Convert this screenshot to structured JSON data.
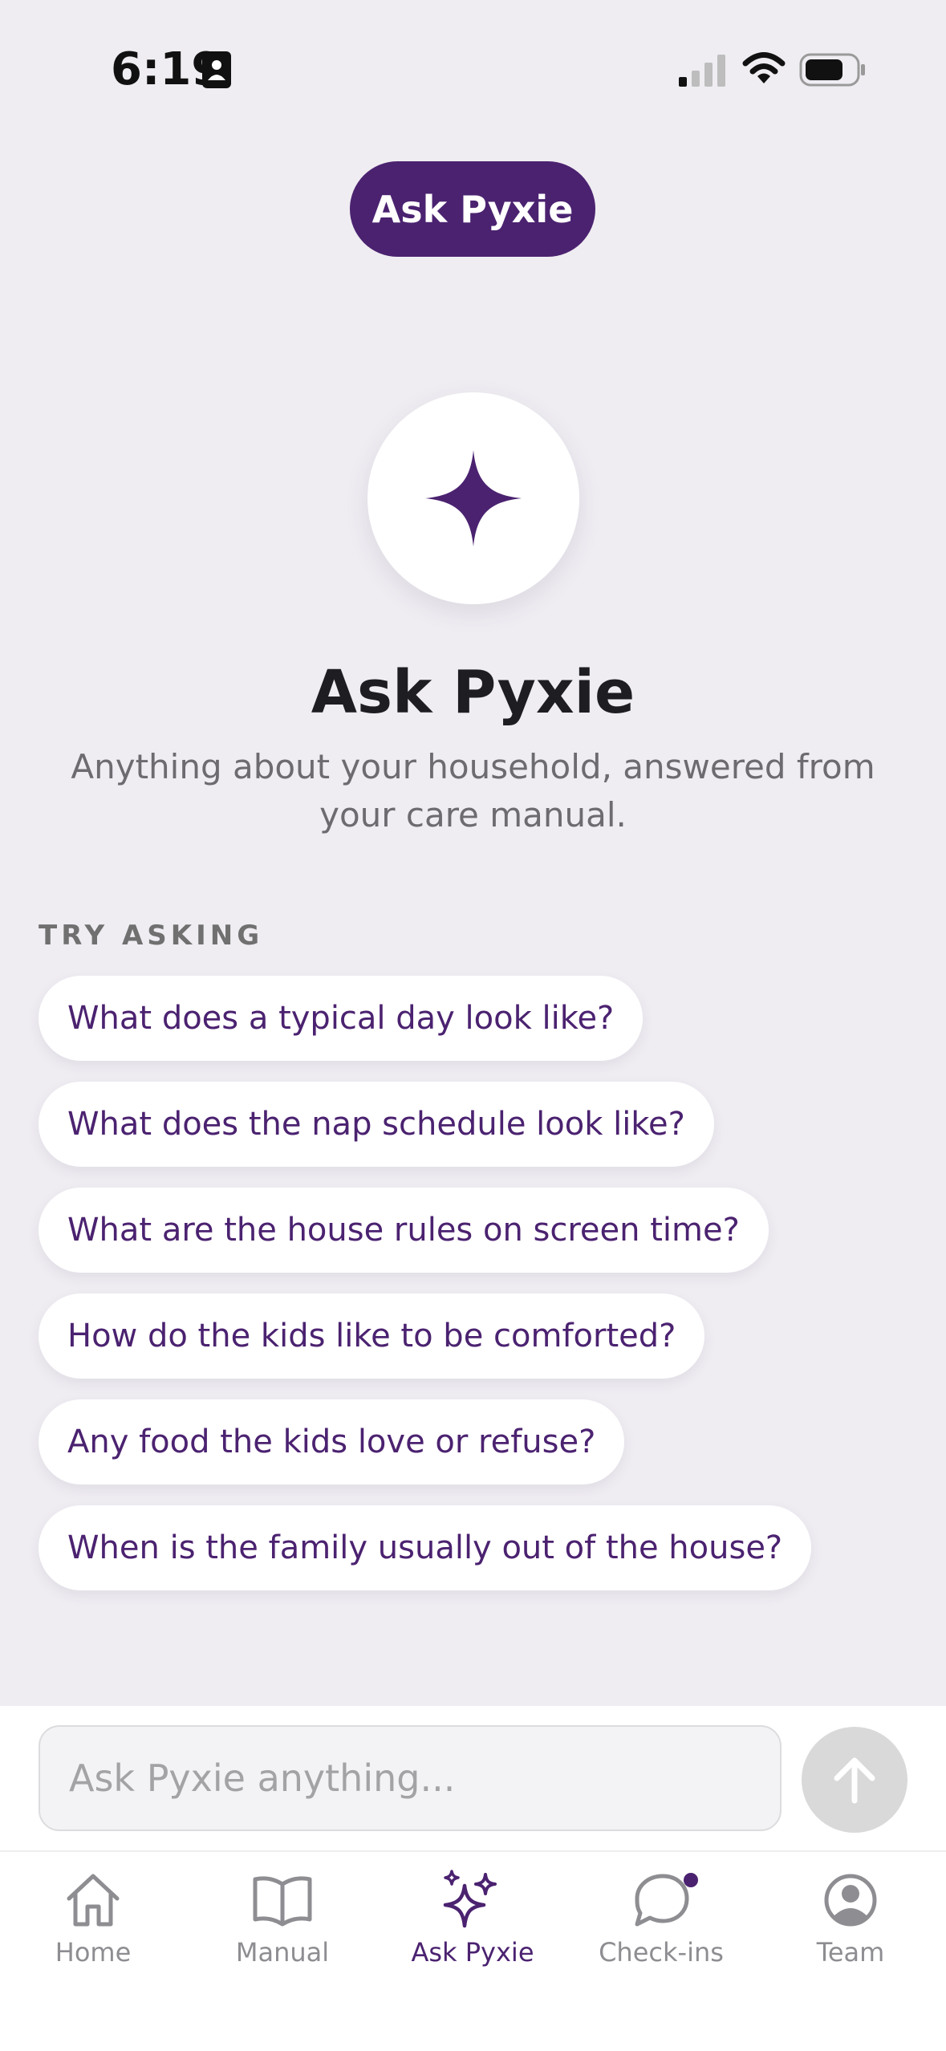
{
  "status_bar": {
    "time": "6:19"
  },
  "header": {
    "title": "Ask Pyxie"
  },
  "hero": {
    "title": "Ask Pyxie",
    "subtitle": "Anything about your household, answered from your care manual."
  },
  "suggestions": {
    "label": "TRY ASKING",
    "items": [
      "What does a typical day look like?",
      "What does the nap schedule look like?",
      "What are the house rules on screen time?",
      "How do the kids like to be comforted?",
      "Any food the kids love or refuse?",
      "When is the family usually out of the house?"
    ]
  },
  "input": {
    "placeholder": "Ask Pyxie anything..."
  },
  "tabs": [
    {
      "label": "Home",
      "icon": "home-icon"
    },
    {
      "label": "Manual",
      "icon": "book-icon"
    },
    {
      "label": "Ask Pyxie",
      "icon": "sparkles-icon",
      "active": true
    },
    {
      "label": "Check-ins",
      "icon": "chat-bubble-icon",
      "has_notification": true
    },
    {
      "label": "Team",
      "icon": "user-circle-icon"
    }
  ],
  "colors": {
    "accent": "#4b2270",
    "background": "#efedf2",
    "tab_inactive": "#8e8d91",
    "send_disabled": "#d9d9d9"
  }
}
